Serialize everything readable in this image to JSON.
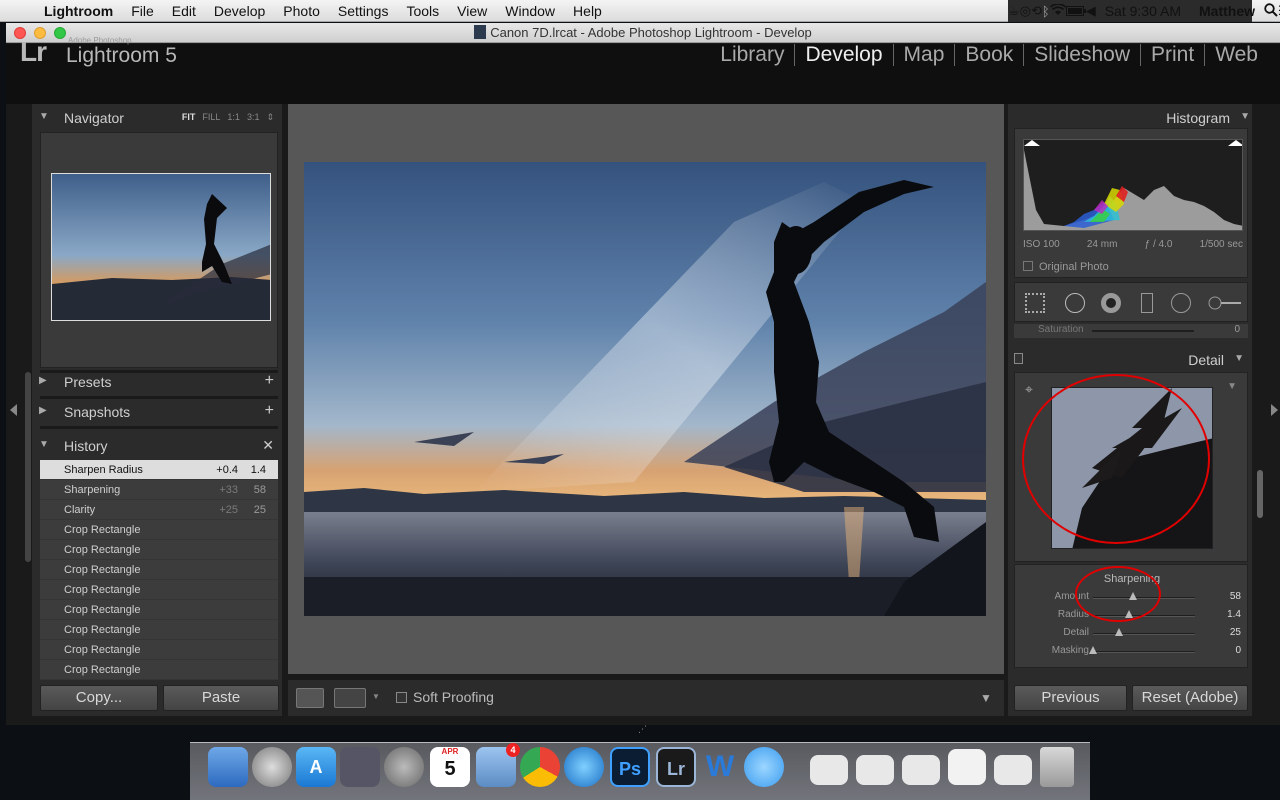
{
  "menubar": {
    "app": "Lightroom",
    "items": [
      "File",
      "Edit",
      "Develop",
      "Photo",
      "Settings",
      "Tools",
      "View",
      "Window",
      "Help"
    ],
    "clock": "Sat 9:30 AM",
    "user": "Matthew"
  },
  "window": {
    "title": "Canon 7D.lrcat - Adobe Photoshop Lightroom - Develop"
  },
  "identity": {
    "logo": "Lr",
    "brand_small": "Adobe Photoshop",
    "product": "Lightroom 5"
  },
  "modules": [
    "Library",
    "Develop",
    "Map",
    "Book",
    "Slideshow",
    "Print",
    "Web"
  ],
  "left": {
    "navigator": {
      "title": "Navigator",
      "modes": [
        "FIT",
        "FILL",
        "1:1",
        "3:1"
      ]
    },
    "presets": "Presets",
    "snapshots": "Snapshots",
    "history_title": "History",
    "history": [
      {
        "name": "Sharpen Radius",
        "delta": "+0.4",
        "value": "1.4"
      },
      {
        "name": "Sharpening",
        "delta": "+33",
        "value": "58"
      },
      {
        "name": "Clarity",
        "delta": "+25",
        "value": "25"
      },
      {
        "name": "Crop Rectangle",
        "delta": "",
        "value": ""
      },
      {
        "name": "Crop Rectangle",
        "delta": "",
        "value": ""
      },
      {
        "name": "Crop Rectangle",
        "delta": "",
        "value": ""
      },
      {
        "name": "Crop Rectangle",
        "delta": "",
        "value": ""
      },
      {
        "name": "Crop Rectangle",
        "delta": "",
        "value": ""
      },
      {
        "name": "Crop Rectangle",
        "delta": "",
        "value": ""
      },
      {
        "name": "Crop Rectangle",
        "delta": "",
        "value": ""
      },
      {
        "name": "Crop Rectangle",
        "delta": "",
        "value": ""
      }
    ],
    "copy_label": "Copy...",
    "paste_label": "Paste"
  },
  "toolbar": {
    "soft_proofing": "Soft Proofing"
  },
  "right": {
    "histogram_title": "Histogram",
    "exif": {
      "iso": "ISO 100",
      "focal": "24 mm",
      "aperture": "ƒ / 4.0",
      "shutter": "1/500 sec"
    },
    "original_photo": "Original Photo",
    "saturation_label": "Saturation",
    "saturation_value": "0",
    "detail_title": "Detail",
    "sharpening_title": "Sharpening",
    "sliders": [
      {
        "label": "Amount",
        "value": "58",
        "position": 0.39
      },
      {
        "label": "Radius",
        "value": "1.4",
        "position": 0.35
      },
      {
        "label": "Detail",
        "value": "25",
        "position": 0.25
      },
      {
        "label": "Masking",
        "value": "0",
        "position": 0.0
      }
    ],
    "previous_label": "Previous",
    "reset_label": "Reset (Adobe)"
  },
  "colors": {
    "annotation": "#e00000",
    "panel": "#2b2b2b",
    "center": "#575757"
  },
  "dock": {
    "calendar_day": "5",
    "calendar_month": "APR",
    "mail_badge": "4",
    "ps_label": "Ps",
    "lr_label": "Lr",
    "word_label": "W"
  }
}
